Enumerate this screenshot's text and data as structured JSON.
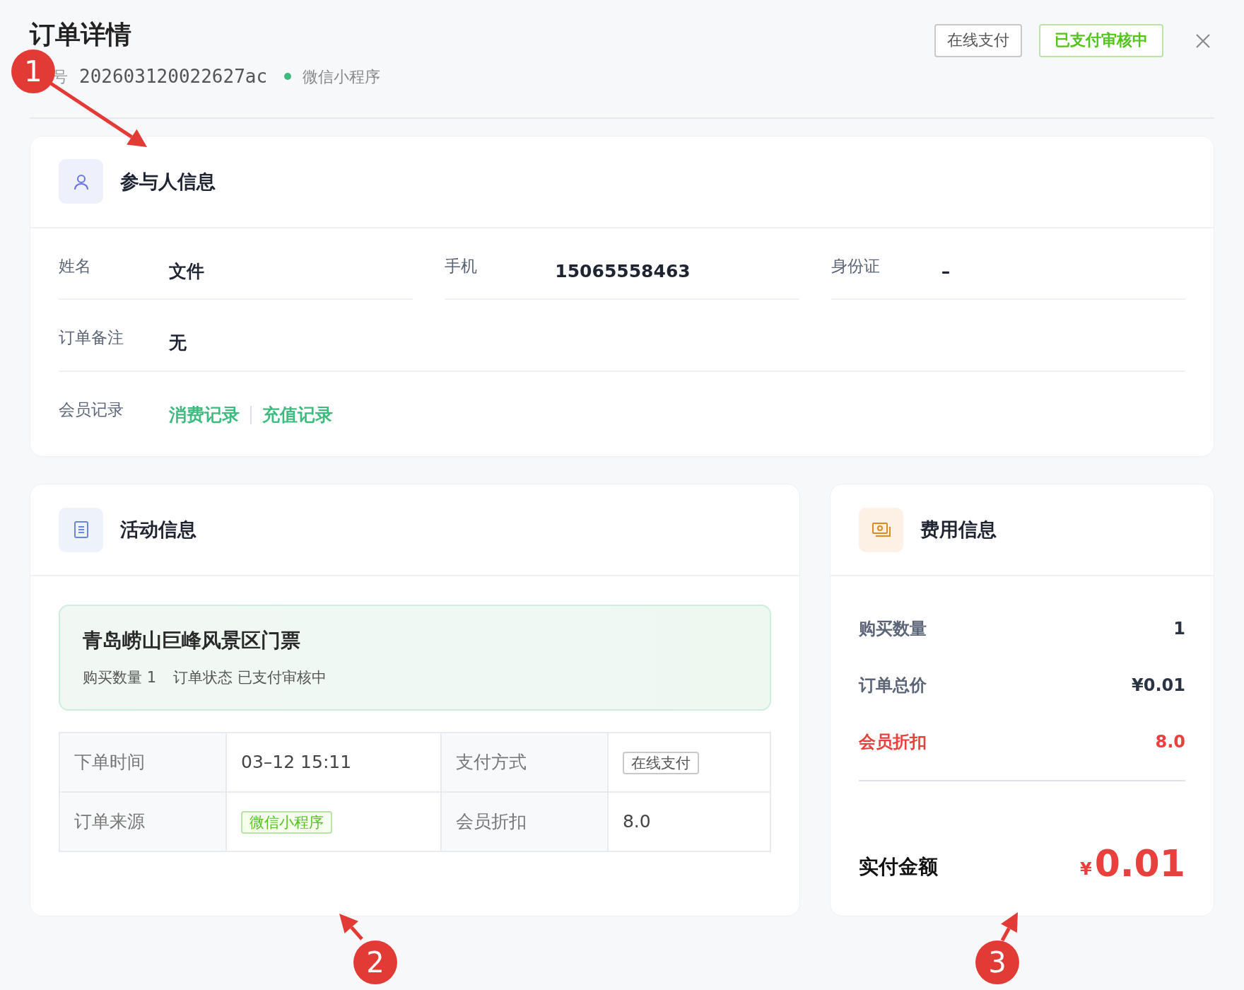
{
  "header": {
    "title": "订单详情",
    "order_label": "号",
    "order_number": "202603120022627ac",
    "source": {
      "label": "微信小程序",
      "color": "#3dbb7f"
    },
    "buttons": [
      {
        "label": "在线支付",
        "kind": "outline"
      },
      {
        "label": "已支付审核中",
        "kind": "status"
      }
    ]
  },
  "participant": {
    "title": "参与人信息",
    "fields": [
      {
        "label": "姓名",
        "value": "文件"
      },
      {
        "label": "手机",
        "value": "15065558463"
      },
      {
        "label": "身份证",
        "value": "–"
      }
    ],
    "remark": {
      "label": "订单备注",
      "value": "无"
    },
    "member": {
      "label": "会员记录",
      "links": [
        "消费记录",
        "充值记录"
      ]
    }
  },
  "activity": {
    "title": "活动信息",
    "ticket": {
      "name": "青岛崂山巨峰风景区门票",
      "summary": [
        "购买数量 1",
        "订单状态 已支付审核中"
      ]
    },
    "details": [
      {
        "label": "下单时间",
        "value": "03–12 15:11",
        "kind": "text"
      },
      {
        "label": "支付方式",
        "value": "在线支付",
        "kind": "tag"
      },
      {
        "label": "订单来源",
        "value": "微信小程序",
        "kind": "success"
      },
      {
        "label": "会员折扣",
        "value": "8.0",
        "kind": "text"
      }
    ]
  },
  "fees": {
    "title": "费用信息",
    "rows": [
      {
        "label": "购买数量",
        "value": "1",
        "highlight": false
      },
      {
        "label": "订单总价",
        "value": "¥0.01",
        "highlight": false
      },
      {
        "label": "会员折扣",
        "value": "8.0",
        "highlight": true
      }
    ],
    "total": {
      "label": "实付金额",
      "currency": "¥",
      "amount": "0.01"
    }
  },
  "annotations": [
    {
      "number": "1"
    },
    {
      "number": "2"
    },
    {
      "number": "3"
    }
  ]
}
